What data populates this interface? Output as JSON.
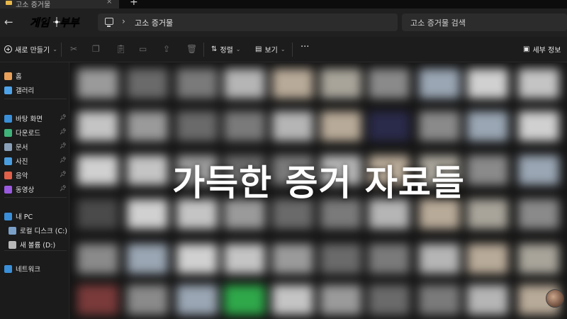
{
  "tab": {
    "label": "고소 증거물",
    "close": "×",
    "new": "+"
  },
  "logo": {
    "text": "게임부부"
  },
  "addressbar": {
    "breadcrumb": "고소 증거물",
    "separator": "›"
  },
  "search": {
    "placeholder": "고소 증거물 검색"
  },
  "commandbar": {
    "new_label": "새로 만들기",
    "sort_label": "정렬",
    "view_label": "보기",
    "more": "···",
    "details_label": "세부 정보"
  },
  "sidebar": {
    "top": [
      {
        "label": "홈",
        "icon": "home-icon",
        "color": "#e8a05a"
      },
      {
        "label": "갤러리",
        "icon": "gallery-icon",
        "color": "#4ea3e8"
      }
    ],
    "quick": [
      {
        "label": "바탕 화면",
        "icon": "desktop-icon",
        "color": "#3a8fd8"
      },
      {
        "label": "다운로드",
        "icon": "download-icon",
        "color": "#3fb37a"
      },
      {
        "label": "문서",
        "icon": "documents-icon",
        "color": "#8aa0b8"
      },
      {
        "label": "사진",
        "icon": "pictures-icon",
        "color": "#4a9ee0"
      },
      {
        "label": "음악",
        "icon": "music-icon",
        "color": "#e0604a"
      },
      {
        "label": "동영상",
        "icon": "videos-icon",
        "color": "#9a5ae0"
      }
    ],
    "pc": [
      {
        "label": "내 PC",
        "icon": "pc-icon",
        "color": "#3a8fd8"
      },
      {
        "label": "로컬 디스크 (C:)",
        "icon": "disk-c-icon",
        "color": "#7aa0c8"
      },
      {
        "label": "새 볼륨 (D:)",
        "icon": "disk-d-icon",
        "color": "#b8b8b8"
      }
    ],
    "network": [
      {
        "label": "네트워크",
        "icon": "network-icon",
        "color": "#3a8fd8"
      }
    ]
  },
  "overlay": {
    "caption": "가득한 증거 자료들"
  }
}
